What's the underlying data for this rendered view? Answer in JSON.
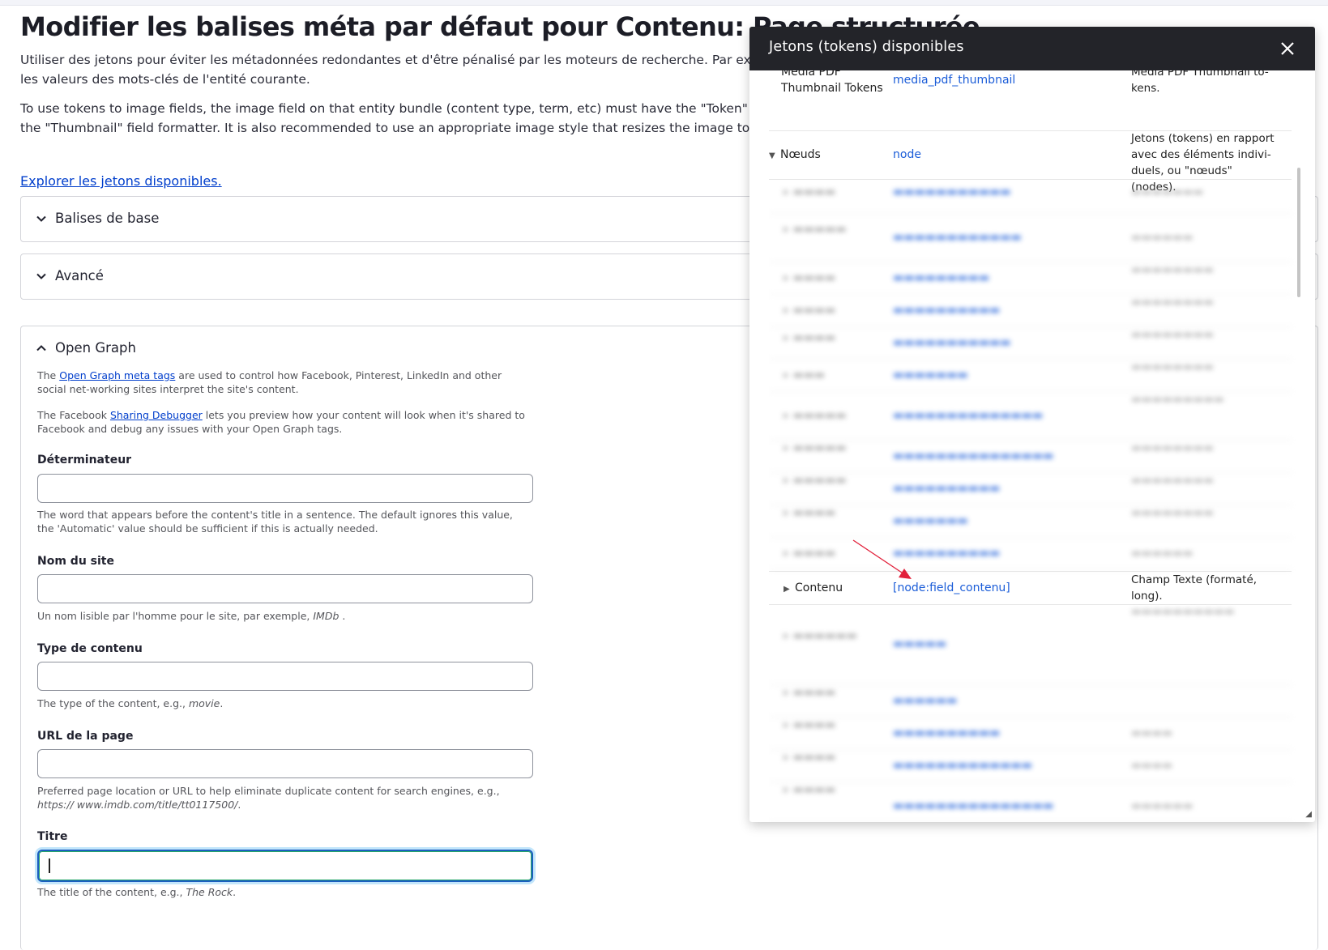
{
  "page": {
    "title": "Modifier les balises méta par défaut pour Contenu: Page structurée",
    "intro_1": "Utiliser des jetons pour éviter les métadonnées redondantes et d'être pénalisé par les moteurs de recherche. Par exemple, que l'utilisation de [node:field_keywords] permet d'insérer automatiquement les valeurs des mots-clés de l'entité courante.",
    "intro_2": "To use tokens to image fields, the image field on that entity bundle (content type, term, etc) must have the \"Token\" display settings enabled and configured to output the URL of the image, e.g. using the \"Thumbnail\" field formatter. It is also recommended to use an appropriate image style that resizes the image to the recommendations.",
    "explore_link": "Explorer les jetons disponibles."
  },
  "accordions": {
    "basic": "Balises de base",
    "advanced": "Avancé",
    "open_graph": "Open Graph"
  },
  "open_graph": {
    "desc1_a": "The ",
    "desc1_link": "Open Graph meta tags",
    "desc1_b": " are used to control how Facebook, Pinterest, LinkedIn and other social net-working sites interpret the site's content.",
    "desc2_a": "The Facebook ",
    "desc2_link": "Sharing Debugger",
    "desc2_b": " lets you preview how your content will look when it's shared to Facebook and debug any issues with your Open Graph tags.",
    "fields": [
      {
        "label": "Déterminateur",
        "help": "The word that appears before the content's title in a sentence. The default ignores this value, the 'Automatic' value should be sufficient if this is actually needed.",
        "value": ""
      },
      {
        "label": "Nom du site",
        "help_a": "Un nom lisible par l'homme pour le site, par exemple, ",
        "help_em": "IMDb",
        "help_b": " .",
        "value": ""
      },
      {
        "label": "Type de contenu",
        "help_a": "The type of the content, e.g., ",
        "help_em": "movie",
        "help_b": ".",
        "value": ""
      },
      {
        "label": "URL de la page",
        "help_a": "Preferred page location or URL to help eliminate duplicate content for search engines, e.g., ",
        "help_em": "https:// www.imdb.com/title/tt0117500/",
        "help_b": ".",
        "value": ""
      },
      {
        "label": "Titre",
        "help_a": "The title of the content, e.g., ",
        "help_em": "The Rock",
        "help_b": ".",
        "value": ""
      }
    ]
  },
  "modal": {
    "title": "Jetons (tokens) disponibles",
    "rows_visible": [
      {
        "name": "Media PDF Thumbnail Tokens",
        "machine": "media_pdf_thumbnail",
        "desc": "Media PDF Thumbnail to-kens."
      },
      {
        "name": "Nœuds",
        "machine": "node",
        "desc": "Jetons (tokens) en rapport avec des éléments indivi-duels, ou \"nœuds\" (nodes)."
      },
      {
        "name": "Contenu",
        "machine": "[node:field_contenu]",
        "desc": "Champ Texte (formaté, long)."
      }
    ]
  }
}
